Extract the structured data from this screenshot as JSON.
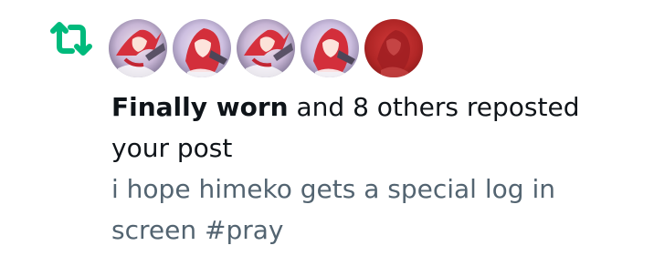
{
  "notification": {
    "icon": "repost-icon",
    "accent_color": "#00ba7c",
    "avatars": [
      {
        "name": "avatar-1",
        "style": "color"
      },
      {
        "name": "avatar-2",
        "style": "color"
      },
      {
        "name": "avatar-3",
        "style": "color"
      },
      {
        "name": "avatar-4",
        "style": "color"
      },
      {
        "name": "avatar-5",
        "style": "red-tint"
      }
    ],
    "actor_name": "Finally worn",
    "action_text": " and 8 others reposted your post",
    "post_preview": "i hope himeko gets a special log in screen #pray",
    "text_color": "#0f1419",
    "muted_color": "#536471"
  }
}
